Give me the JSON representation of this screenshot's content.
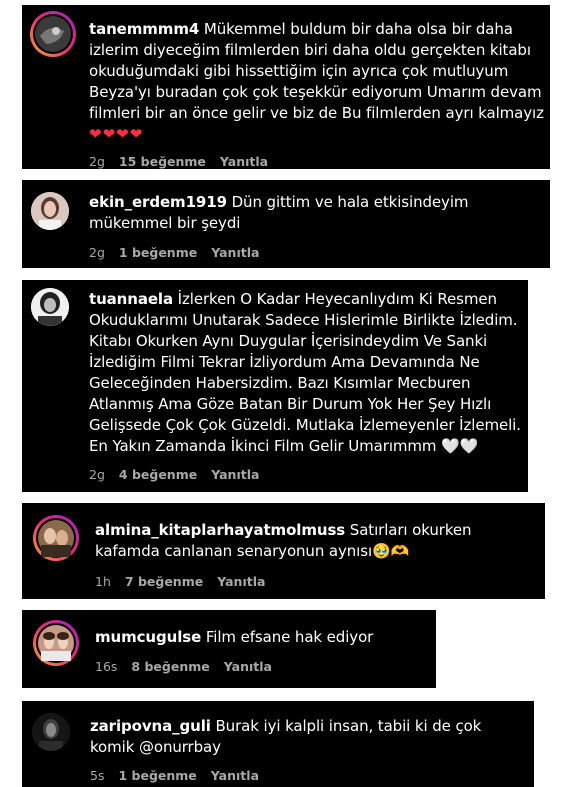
{
  "comments": [
    {
      "username": "tanemmmm4",
      "text": "Mükemmel buldum bir daha olsa bir daha izlerim diyeceğim filmlerden biri daha oldu gerçekten kitabı okuduğumdaki gibi hissettiğim için ayrıca çok mutluyum Beyza'yı buradan çok çok teşekkür ediyorum Umarım devam filmleri bir an önce gelir ve biz de Bu filmlerden ayrı kalmayız",
      "emoji": "❤❤❤❤",
      "time": "2g",
      "likes": "15 beğenme",
      "reply": "Yanıtla"
    },
    {
      "username": "ekin_erdem1919",
      "text": "Dün gittim ve hala etkisindeyim mükemmel bir şeydi",
      "emoji": "",
      "time": "2g",
      "likes": "1 beğenme",
      "reply": "Yanıtla"
    },
    {
      "username": "tuannaela",
      "text": "İzlerken O Kadar Heyecanlıydım Ki Resmen Okuduklarımı Unutarak Sadece Hislerimle Birlikte İzledim. Kitabı Okurken Aynı Duygular İçerisindeydim Ve Sanki İzlediğim Filmi Tekrar İzliyordum Ama Devamında Ne Geleceğinden Habersizdim. Bazı Kısımlar Mecburen Atlanmış Ama Göze Batan Bir Durum Yok Her Şey Hızlı Gelişsede Çok Çok Güzeldi. Mutlaka İzlemeyenler İzlemeli. En Yakın Zamanda İkinci Film Gelir Umarımmm",
      "emoji": "🤍🤍",
      "time": "2g",
      "likes": "4 beğenme",
      "reply": "Yanıtla"
    },
    {
      "username": "almina_kitaplarhayatmolmuss",
      "text": "Satırları okurken kafamda canlanan senaryonun aynısı",
      "emoji": "🥹🫶",
      "time": "1h",
      "likes": "7 beğenme",
      "reply": "Yanıtla"
    },
    {
      "username": "mumcugulse",
      "text": "Film efsane hak ediyor",
      "emoji": "",
      "time": "16s",
      "likes": "8 beğenme",
      "reply": "Yanıtla"
    },
    {
      "username": "zaripovna_guli",
      "text": "Burak iyi kalpli insan, tabii ki de çok komik @onurrbay",
      "emoji": "",
      "time": "5s",
      "likes": "1 beğenme",
      "reply": "Yanıtla"
    }
  ]
}
